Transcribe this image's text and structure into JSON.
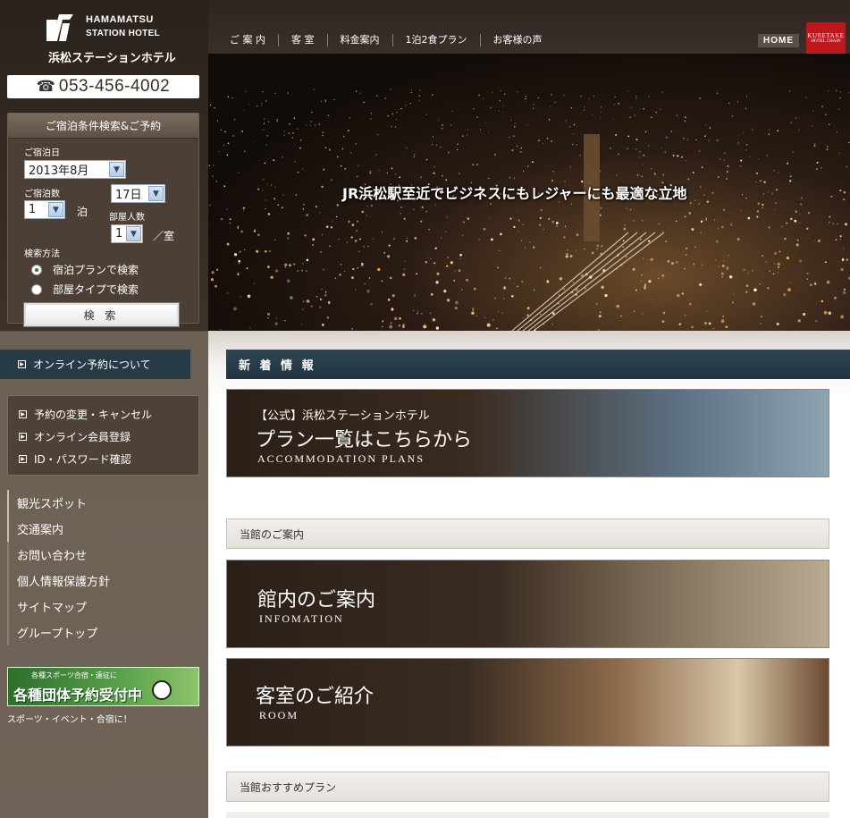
{
  "logo": {
    "en_line1": "HAMAMATSU",
    "en_line2": "STATION HOTEL",
    "jp": "浜松ステーションホテル"
  },
  "phone": {
    "icon": "phone-icon",
    "glyph": "☎",
    "number": "053-456-4002"
  },
  "search": {
    "title": "ご宿泊条件検索&ご予約",
    "date_label": "ご宿泊日",
    "month_value": "2013年8月",
    "day_value": "17日",
    "nights_label": "ご宿泊数",
    "nights_value": "1",
    "nights_unit": "泊",
    "rooms_label": "部屋人数",
    "people_value": "1",
    "people_unit": "／室",
    "method_label": "検索方法",
    "option_plan": "宿泊プランで検索",
    "option_room": "部屋タイプで検索",
    "selected_method": "plan",
    "button": "検 索"
  },
  "online_tab": "オンライン予約について",
  "member": {
    "items": [
      "予約の変更・キャンセル",
      "オンライン会員登録",
      "ID・パスワード確認"
    ]
  },
  "nav_links": [
    "観光スポット",
    "交通案内",
    "お問い合わせ",
    "個人情報保護方針",
    "サイトマップ",
    "グループトップ"
  ],
  "sports_banner": {
    "small": "各種スポーツ合宿・遠征に",
    "big": "各種団体予約受付中",
    "caption": "スポーツ・イベント・合宿に！"
  },
  "topnav": [
    "ご 案 内",
    "客 室",
    "料金案内",
    "1泊2食プラン",
    "お客様の声"
  ],
  "home_button": "HOME",
  "kuretake": {
    "line1": "KURETAKE",
    "line2": "HOTEL CHAIN"
  },
  "hero": {
    "caption": "JR浜松駅至近でビジネスにもレジャーにも最適な立地"
  },
  "news_header": "新 着 情 報",
  "plans_banner": {
    "small": "【公式】浜松ステーションホテル",
    "big": "プラン一覧はこちらから",
    "en": "ACCOMMODATION PLANS"
  },
  "section_guide": "当館のご案内",
  "info_banner": {
    "big": "館内のご案内",
    "en": "INFOMATION"
  },
  "room_banner": {
    "big": "客室のご紹介",
    "en": "ROOM"
  },
  "section_recommend": "当館おすすめプラン",
  "colors": {
    "sidebar_dark": "#3d342c",
    "nav_blue": "#263a47",
    "brand_red": "#c0161b"
  }
}
